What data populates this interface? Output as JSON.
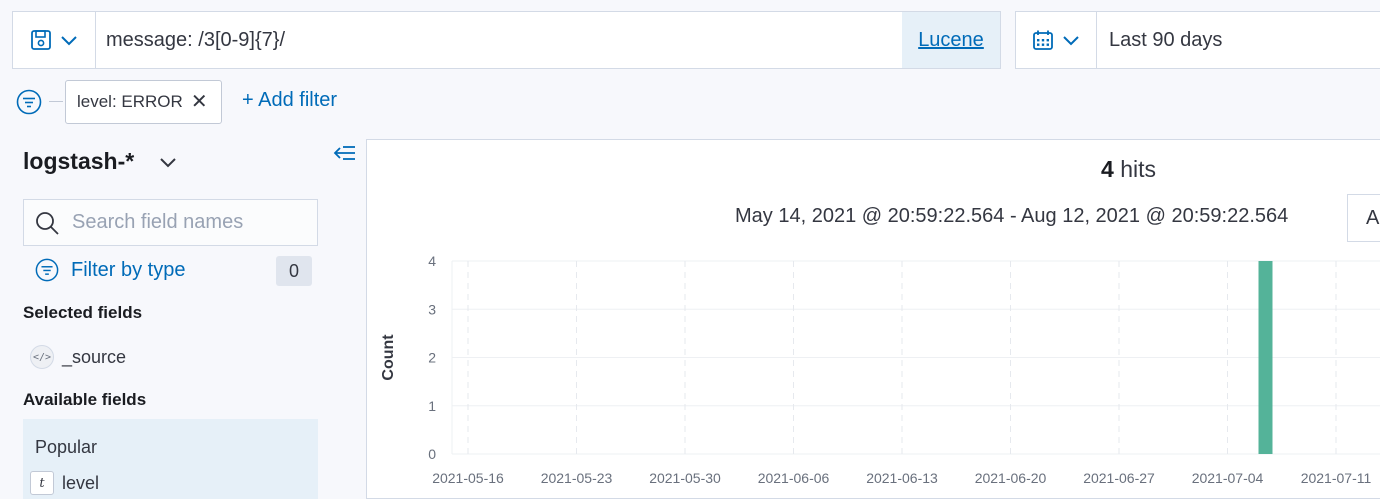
{
  "query": {
    "value": "message: /3[0-9]{7}/",
    "language": "Lucene"
  },
  "date_picker": {
    "label": "Last 90 days"
  },
  "filters": {
    "pills": [
      {
        "label": "level: ERROR"
      }
    ],
    "add_label": "+ Add filter"
  },
  "sidebar": {
    "index_pattern": "logstash-*",
    "search_placeholder": "Search field names",
    "filter_by_type": "Filter by type",
    "filter_count": "0",
    "selected_title": "Selected fields",
    "selected_fields": [
      {
        "name": "_source"
      }
    ],
    "available_title": "Available fields",
    "popular_title": "Popular",
    "popular_fields": [
      {
        "name": "level",
        "type_badge": "t"
      }
    ]
  },
  "results": {
    "hits_count": "4",
    "hits_word": "hits",
    "time_range": "May 14, 2021 @ 20:59:22.564 - Aug 12, 2021 @ 20:59:22.564",
    "interval_label_partial": "A"
  },
  "colors": {
    "accent": "#006bb8",
    "bar": "#54b399"
  },
  "chart_data": {
    "type": "bar",
    "ylabel": "Count",
    "xlabel": "",
    "ylim": [
      0,
      4
    ],
    "y_ticks": [
      "0",
      "1",
      "2",
      "3",
      "4"
    ],
    "x_ticks": [
      "2021-05-16",
      "2021-05-23",
      "2021-05-30",
      "2021-06-06",
      "2021-06-13",
      "2021-06-20",
      "2021-06-27",
      "2021-07-04",
      "2021-07-11"
    ],
    "bars": [
      {
        "x": "2021-07-06",
        "value": 4
      }
    ],
    "grid": true
  }
}
